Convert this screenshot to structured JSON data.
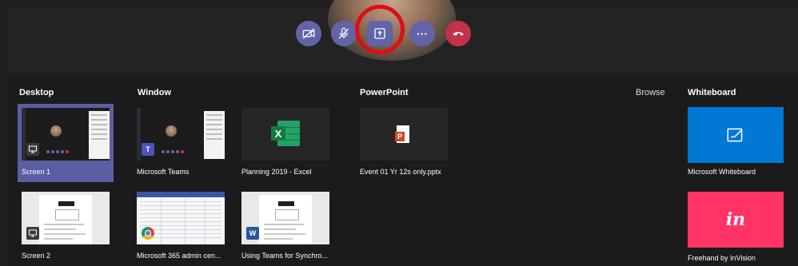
{
  "call_controls": {
    "buttons": [
      {
        "name": "camera-off",
        "icon": "camera-off-icon"
      },
      {
        "name": "mic-off",
        "icon": "mic-off-icon"
      },
      {
        "name": "share",
        "icon": "share-screen-icon"
      },
      {
        "name": "more",
        "icon": "more-icon",
        "glyph": "···"
      },
      {
        "name": "hang-up",
        "icon": "hang-up-icon"
      }
    ]
  },
  "tray": {
    "sections": {
      "desktop": "Desktop",
      "window": "Window",
      "powerpoint": "PowerPoint",
      "browse": "Browse",
      "whiteboard": "Whiteboard"
    },
    "desktop_items": [
      {
        "label": "Screen 1",
        "selected": true
      },
      {
        "label": "Screen 2",
        "selected": false
      }
    ],
    "window_items": [
      {
        "label": "Microsoft Teams",
        "badge": "T"
      },
      {
        "label": "Planning 2019 - Excel"
      },
      {
        "label": "Microsoft 365 admin cen..."
      },
      {
        "label": "Using Teams for Synchro...",
        "badge": "W"
      }
    ],
    "powerpoint_items": [
      {
        "label": "Event 01 Yr 12s only.pptx"
      }
    ],
    "whiteboard_items": [
      {
        "label": "Microsoft Whiteboard"
      },
      {
        "label": "Freehand by InVision",
        "mark": "in"
      }
    ]
  },
  "colors": {
    "accent": "#6264a7",
    "hangup": "#c4314b",
    "highlight_ring": "#e00d14",
    "ms_whiteboard": "#0078d4",
    "invision": "#ff3366"
  }
}
